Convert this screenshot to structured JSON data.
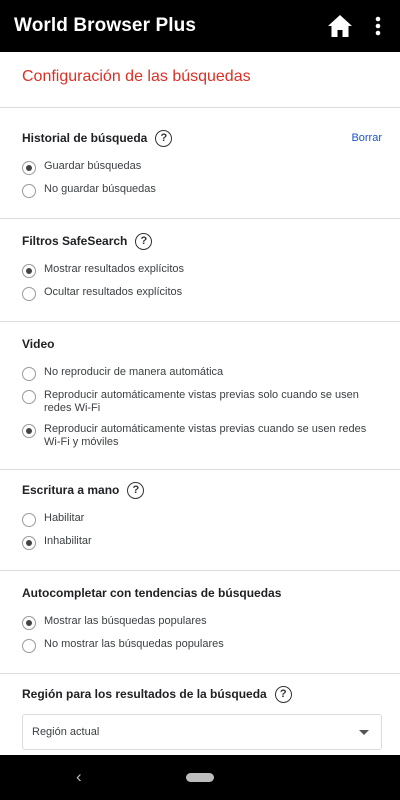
{
  "app": {
    "title": "World Browser Plus",
    "home_icon": "home-icon",
    "menu_icon": "more-vert-icon"
  },
  "page": {
    "title": "Configuración de las búsquedas"
  },
  "sections": {
    "history": {
      "title": "Historial de búsqueda",
      "action": "Borrar",
      "options": [
        "Guardar búsquedas",
        "No guardar búsquedas"
      ],
      "selected": 0
    },
    "safesearch": {
      "title": "Filtros SafeSearch",
      "options": [
        "Mostrar resultados explícitos",
        "Ocultar resultados explícitos"
      ],
      "selected": 0
    },
    "video": {
      "title": "Video",
      "options": [
        "No reproducir de manera automática",
        "Reproducir automáticamente vistas previas solo cuando se usen redes Wi-Fi",
        "Reproducir automáticamente vistas previas cuando se usen redes Wi-Fi y móviles"
      ],
      "selected": 2
    },
    "handwriting": {
      "title": "Escritura a mano",
      "options": [
        "Habilitar",
        "Inhabilitar"
      ],
      "selected": 1
    },
    "autocomplete": {
      "title": "Autocompletar con tendencias de búsquedas",
      "options": [
        "Mostrar las búsquedas populares",
        "No mostrar las búsquedas populares"
      ],
      "selected": 0
    },
    "region": {
      "title": "Región para los resultados de la búsqueda",
      "value": "Región actual"
    }
  },
  "colors": {
    "title_red": "#d93025",
    "link_blue": "#1a56c8",
    "bar_black": "#000000"
  }
}
